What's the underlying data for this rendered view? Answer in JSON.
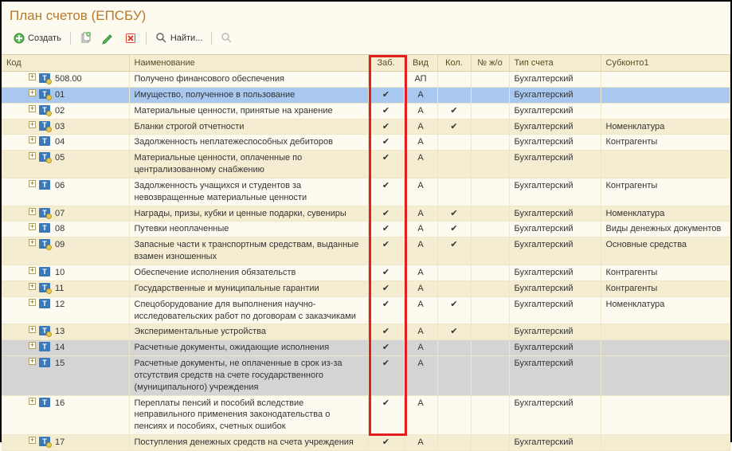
{
  "title": "План счетов (ЕПСБУ)",
  "toolbar": {
    "create": "Создать",
    "find": "Найти..."
  },
  "columns": {
    "code": "Код",
    "name": "Наименование",
    "zab": "Заб.",
    "vid": "Вид",
    "kol": "Кол.",
    "njo": "№ ж/о",
    "type": "Тип счета",
    "sub": "Субконто1"
  },
  "rows": [
    {
      "code": "508.00",
      "name": "Получено финансового обеспечения",
      "zab": "",
      "vid": "АП",
      "kol": "",
      "type": "Бухгалтерский",
      "sub": "",
      "indent": 28,
      "style": "odd",
      "iconsub": true
    },
    {
      "code": "01",
      "name": "Имущество, полученное в пользование",
      "zab": "✔",
      "vid": "А",
      "kol": "",
      "type": "Бухгалтерский",
      "sub": "",
      "indent": 28,
      "style": "selected",
      "iconsub": true
    },
    {
      "code": "02",
      "name": "Материальные ценности, принятые на хранение",
      "zab": "✔",
      "vid": "А",
      "kol": "✔",
      "type": "Бухгалтерский",
      "sub": "",
      "indent": 28,
      "style": "odd",
      "iconsub": true
    },
    {
      "code": "03",
      "name": "Бланки строгой отчетности",
      "zab": "✔",
      "vid": "А",
      "kol": "✔",
      "type": "Бухгалтерский",
      "sub": "Номенклатура",
      "indent": 28,
      "style": "even",
      "iconsub": true
    },
    {
      "code": "04",
      "name": "Задолженность неплатежеспособных дебиторов",
      "zab": "✔",
      "vid": "А",
      "kol": "",
      "type": "Бухгалтерский",
      "sub": "Контрагенты",
      "indent": 28,
      "style": "odd",
      "iconsub": false
    },
    {
      "code": "05",
      "name": "Материальные ценности, оплаченные по централизованному снабжению",
      "zab": "✔",
      "vid": "А",
      "kol": "",
      "type": "Бухгалтерский",
      "sub": "",
      "indent": 28,
      "style": "even",
      "iconsub": true
    },
    {
      "code": "06",
      "name": "Задолженность учащихся и студентов за невозвращенные материальные ценности",
      "zab": "✔",
      "vid": "А",
      "kol": "",
      "type": "Бухгалтерский",
      "sub": "Контрагенты",
      "indent": 28,
      "style": "odd",
      "iconsub": false
    },
    {
      "code": "07",
      "name": "Награды, призы, кубки и ценные подарки, сувениры",
      "zab": "✔",
      "vid": "А",
      "kol": "✔",
      "type": "Бухгалтерский",
      "sub": "Номенклатура",
      "indent": 28,
      "style": "even",
      "iconsub": true
    },
    {
      "code": "08",
      "name": "Путевки неоплаченные",
      "zab": "✔",
      "vid": "А",
      "kol": "✔",
      "type": "Бухгалтерский",
      "sub": "Виды денежных документов",
      "indent": 28,
      "style": "odd",
      "iconsub": false
    },
    {
      "code": "09",
      "name": "Запасные части к транспортным средствам, выданные взамен изношенных",
      "zab": "✔",
      "vid": "А",
      "kol": "✔",
      "type": "Бухгалтерский",
      "sub": "Основные средства",
      "indent": 28,
      "style": "even",
      "iconsub": true
    },
    {
      "code": "10",
      "name": "Обеспечение исполнения обязательств",
      "zab": "✔",
      "vid": "А",
      "kol": "",
      "type": "Бухгалтерский",
      "sub": "Контрагенты",
      "indent": 28,
      "style": "odd",
      "iconsub": false
    },
    {
      "code": "11",
      "name": "Государственные и муниципальные гарантии",
      "zab": "✔",
      "vid": "А",
      "kol": "",
      "type": "Бухгалтерский",
      "sub": "Контрагенты",
      "indent": 28,
      "style": "even",
      "iconsub": true
    },
    {
      "code": "12",
      "name": "Спецоборудование для выполнения научно-исследовательских работ по договорам с заказчиками",
      "zab": "✔",
      "vid": "А",
      "kol": "✔",
      "type": "Бухгалтерский",
      "sub": "Номенклатура",
      "indent": 28,
      "style": "odd",
      "iconsub": false
    },
    {
      "code": "13",
      "name": "Экспериментальные устройства",
      "zab": "✔",
      "vid": "А",
      "kol": "✔",
      "type": "Бухгалтерский",
      "sub": "",
      "indent": 28,
      "style": "even",
      "iconsub": true
    },
    {
      "code": "14",
      "name": "Расчетные документы, ожидающие исполнения",
      "zab": "✔",
      "vid": "А",
      "kol": "",
      "type": "Бухгалтерский",
      "sub": "",
      "indent": 28,
      "style": "grey",
      "iconsub": false
    },
    {
      "code": "15",
      "name": "Расчетные документы, не оплаченные в срок из-за отсутствия средств на счете государственного (муниципального) учреждения",
      "zab": "✔",
      "vid": "А",
      "kol": "",
      "type": "Бухгалтерский",
      "sub": "",
      "indent": 28,
      "style": "grey",
      "iconsub": false
    },
    {
      "code": "16",
      "name": "Переплаты пенсий и пособий вследствие неправильного применения законодательства о пенсиях и пособиях, счетных ошибок",
      "zab": "✔",
      "vid": "А",
      "kol": "",
      "type": "Бухгалтерский",
      "sub": "",
      "indent": 28,
      "style": "odd",
      "iconsub": false
    },
    {
      "code": "17",
      "name": "Поступления денежных средств на счета учреждения",
      "zab": "✔",
      "vid": "А",
      "kol": "",
      "type": "Бухгалтерский",
      "sub": "",
      "indent": 28,
      "style": "even",
      "iconsub": true
    }
  ]
}
